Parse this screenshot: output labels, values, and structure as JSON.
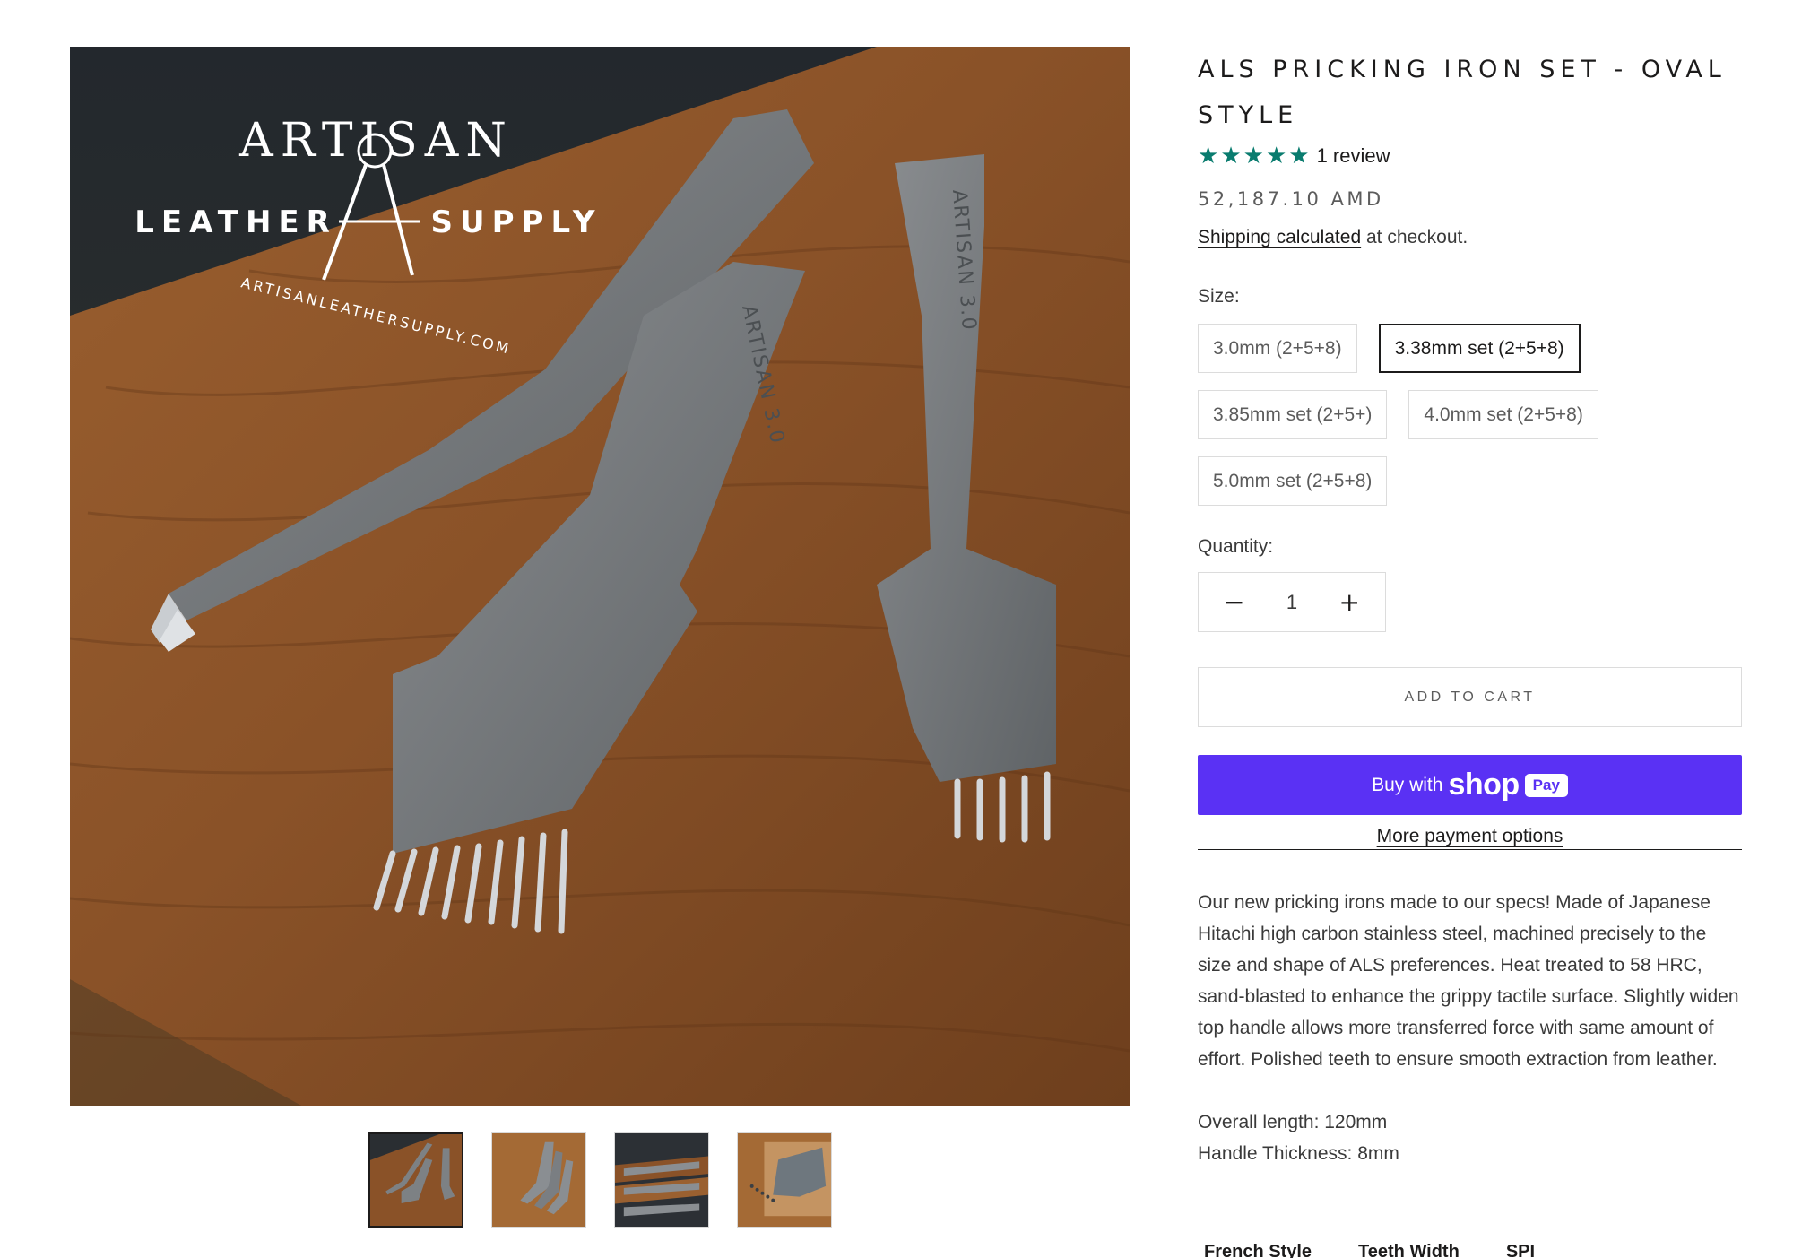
{
  "logo": {
    "line1": "ARTISAN",
    "line2_left": "LEATHER",
    "line2_right": "SUPPLY",
    "url": "ARTISANLEATHERSUPPLY.COM"
  },
  "product": {
    "title": "ALS Pricking Iron Set - Oval Style",
    "rating_value": 5,
    "rating_stars": "★★★★★",
    "review_text": "1 review",
    "price": "52,187.10 AMD",
    "shipping_link": "Shipping calculated",
    "shipping_suffix": " at checkout."
  },
  "size": {
    "label": "Size:",
    "options": [
      "3.0mm (2+5+8)",
      "3.38mm set (2+5+8)",
      "3.85mm set (2+5+)",
      "4.0mm set (2+5+8)",
      "5.0mm set (2+5+8)"
    ],
    "selected": "3.38mm set (2+5+8)"
  },
  "quantity": {
    "label": "Quantity:",
    "value": "1",
    "minus": "−",
    "plus": "+"
  },
  "buttons": {
    "add_to_cart": "ADD TO CART",
    "buy_with": "Buy with",
    "shop": "shop",
    "pay": "Pay",
    "more_options": "More payment options"
  },
  "description": {
    "paragraph": "Our new pricking irons made to our specs! Made of Japanese Hitachi high carbon stainless steel, machined precisely to the size and shape of ALS preferences. Heat treated to 58 HRC, sand-blasted to enhance the grippy tactile surface. Slightly widen top handle allows more transferred force with same amount of effort. Polished teeth to ensure smooth extraction from leather.",
    "overall_length": "Overall length: 120mm",
    "handle_thickness": "Handle Thickness:  8mm"
  },
  "table": {
    "headers": [
      "French Style",
      "Teeth Width",
      "SPI"
    ]
  },
  "iron_engravings": {
    "left": "ARTISAN 3.0",
    "middle": "ARTISAN 3.0",
    "right": "ARTISAN 3.0"
  },
  "colors": {
    "star": "#0a7c6f",
    "shop_pay": "#5a31f4",
    "text": "#1c1b1b"
  }
}
